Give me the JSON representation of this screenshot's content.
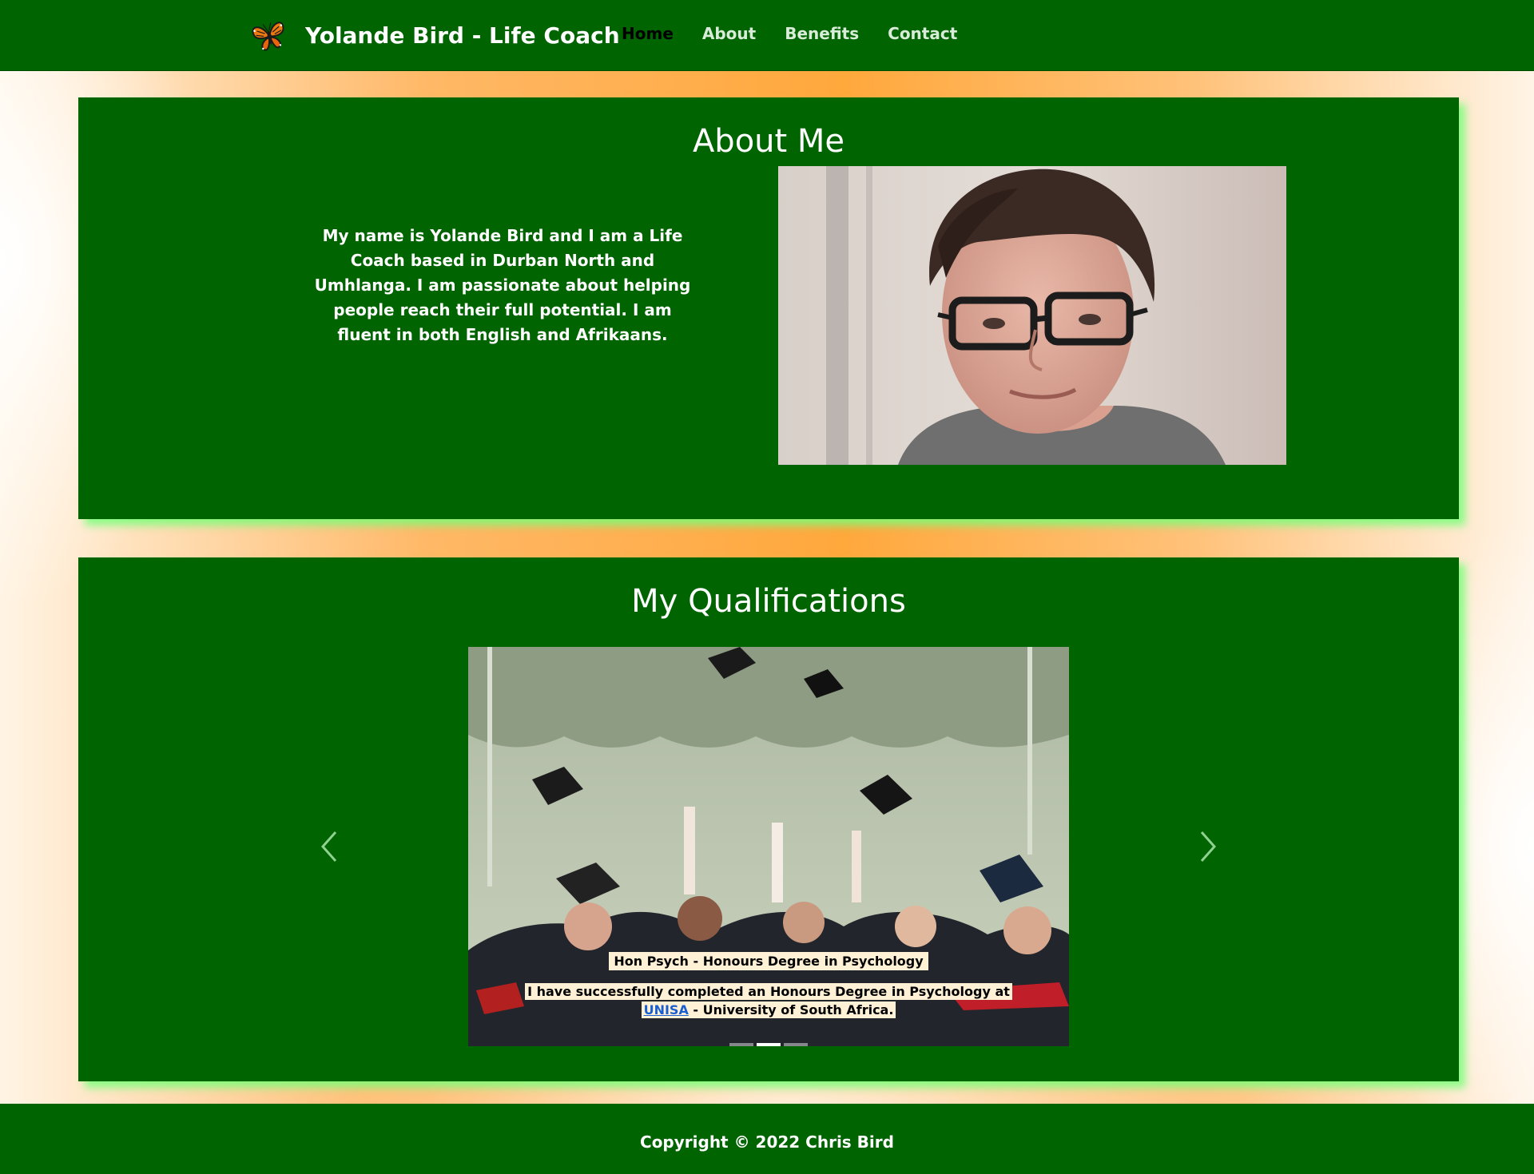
{
  "navbar": {
    "brand_title": "Yolande Bird - Life Coach",
    "brand_icon": "butterfly-icon",
    "links": [
      {
        "label": "Home",
        "active": true
      },
      {
        "label": "About",
        "active": false
      },
      {
        "label": "Benefits",
        "active": false
      },
      {
        "label": "Contact",
        "active": false
      }
    ]
  },
  "about": {
    "heading": "About Me",
    "text": "My name is Yolande Bird and I am a Life Coach based in Durban North and Umhlanga. I am passionate about helping people reach their full potential. I am fluent in both English and Afrikaans."
  },
  "qualifications": {
    "heading": "My Qualifications",
    "slide": {
      "title": "Hon Psych - Honours Degree in Psychology",
      "text_line1": "I have successfully completed an Honours Degree in Psychology at",
      "link_text": "UNISA",
      "text_line2_rest": " - University of South Africa."
    },
    "indicator_count": 3,
    "active_indicator": 2,
    "prev_icon": "chevron-left-icon",
    "next_icon": "chevron-right-icon"
  },
  "footer": {
    "copyright": "Copyright © 2022 Chris Bird"
  },
  "colors": {
    "primary_green": "#006400",
    "card_shadow": "#78ff78",
    "background_orange": "#ffa83c",
    "caption_bg": "#fff1d6",
    "link_blue": "#1a5fd1"
  }
}
